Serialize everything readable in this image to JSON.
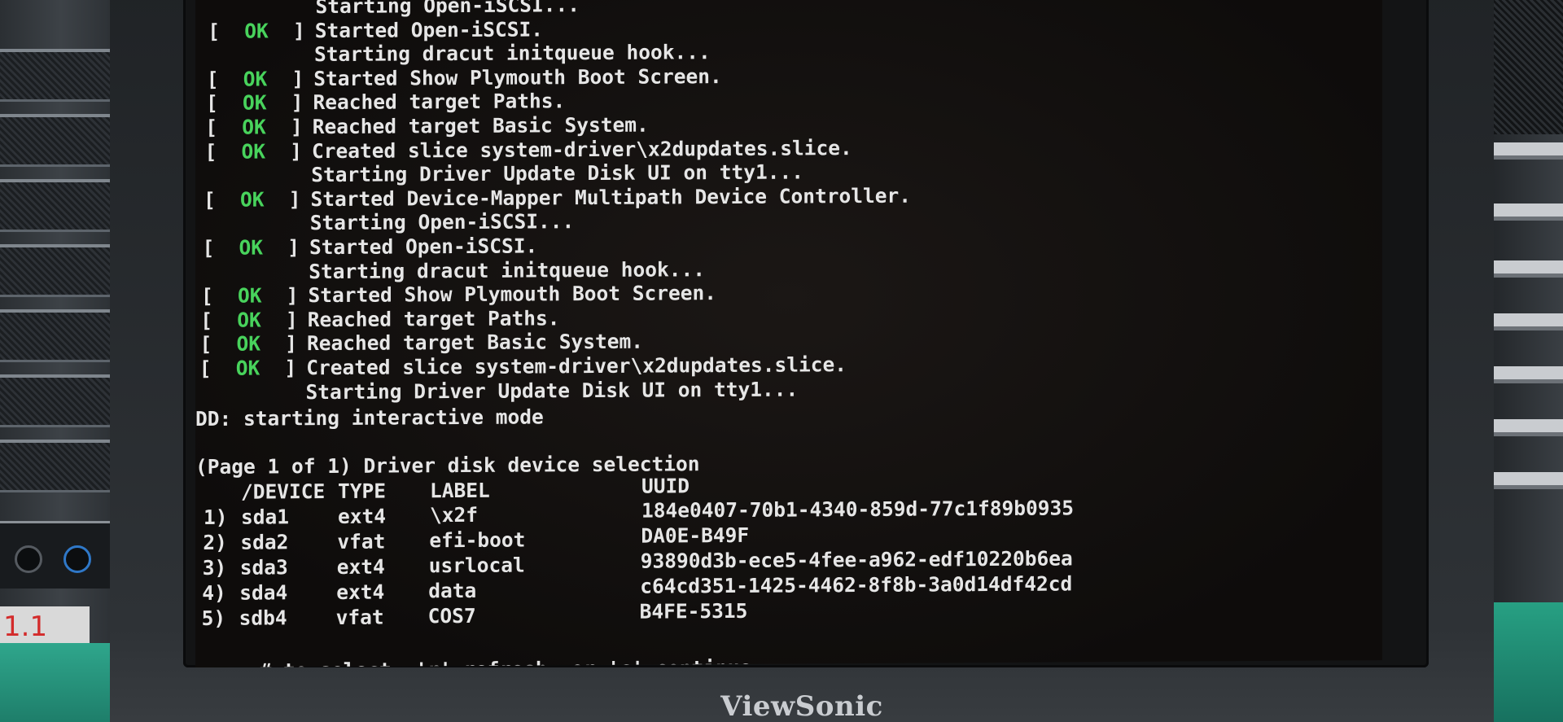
{
  "console": {
    "boot_lines": [
      {
        "status": "",
        "text": "Starting Open-iSCSI..."
      },
      {
        "status": "OK",
        "text": "Started Open-iSCSI."
      },
      {
        "status": "",
        "text": "Starting dracut initqueue hook..."
      },
      {
        "status": "OK",
        "text": "Started Show Plymouth Boot Screen."
      },
      {
        "status": "OK",
        "text": "Reached target Paths."
      },
      {
        "status": "OK",
        "text": "Reached target Basic System."
      },
      {
        "status": "OK",
        "text": "Created slice system-driver\\x2dupdates.slice."
      },
      {
        "status": "",
        "text": "Starting Driver Update Disk UI on tty1..."
      },
      {
        "status": "OK",
        "text": "Started Device-Mapper Multipath Device Controller."
      },
      {
        "status": "",
        "text": "Starting Open-iSCSI..."
      },
      {
        "status": "OK",
        "text": "Started Open-iSCSI."
      },
      {
        "status": "",
        "text": "Starting dracut initqueue hook..."
      },
      {
        "status": "OK",
        "text": "Started Show Plymouth Boot Screen."
      },
      {
        "status": "OK",
        "text": "Reached target Paths."
      },
      {
        "status": "OK",
        "text": "Reached target Basic System."
      },
      {
        "status": "OK",
        "text": "Created slice system-driver\\x2dupdates.slice."
      },
      {
        "status": "",
        "text": "Starting Driver Update Disk UI on tty1..."
      }
    ],
    "dd_message": "DD: starting interactive mode",
    "selection_title": "(Page 1 of 1) Driver disk device selection",
    "table_headers": {
      "device": "/DEVICE",
      "type": "TYPE",
      "label": "LABEL",
      "uuid": "UUID"
    },
    "devices": [
      {
        "num": "1)",
        "device": "sda1",
        "type": "ext4",
        "label": "\\x2f",
        "uuid": "184e0407-70b1-4340-859d-77c1f89b0935"
      },
      {
        "num": "2)",
        "device": "sda2",
        "type": "vfat",
        "label": "efi-boot",
        "uuid": "DA0E-B49F"
      },
      {
        "num": "3)",
        "device": "sda3",
        "type": "ext4",
        "label": "usrlocal",
        "uuid": "93890d3b-ece5-4fee-a962-edf10220b6ea"
      },
      {
        "num": "4)",
        "device": "sda4",
        "type": "ext4",
        "label": "data",
        "uuid": "c64cd351-1425-4462-8f8b-3a0d14df42cd"
      },
      {
        "num": "5)",
        "device": "sdb4",
        "type": "vfat",
        "label": "COS7",
        "uuid": "B4FE-5315"
      }
    ],
    "prompt": "# to select, 'r'-refresh, or 'c'-continue:"
  },
  "monitor": {
    "brand": "ViewSonic"
  },
  "background": {
    "tag_text": "1.1"
  }
}
